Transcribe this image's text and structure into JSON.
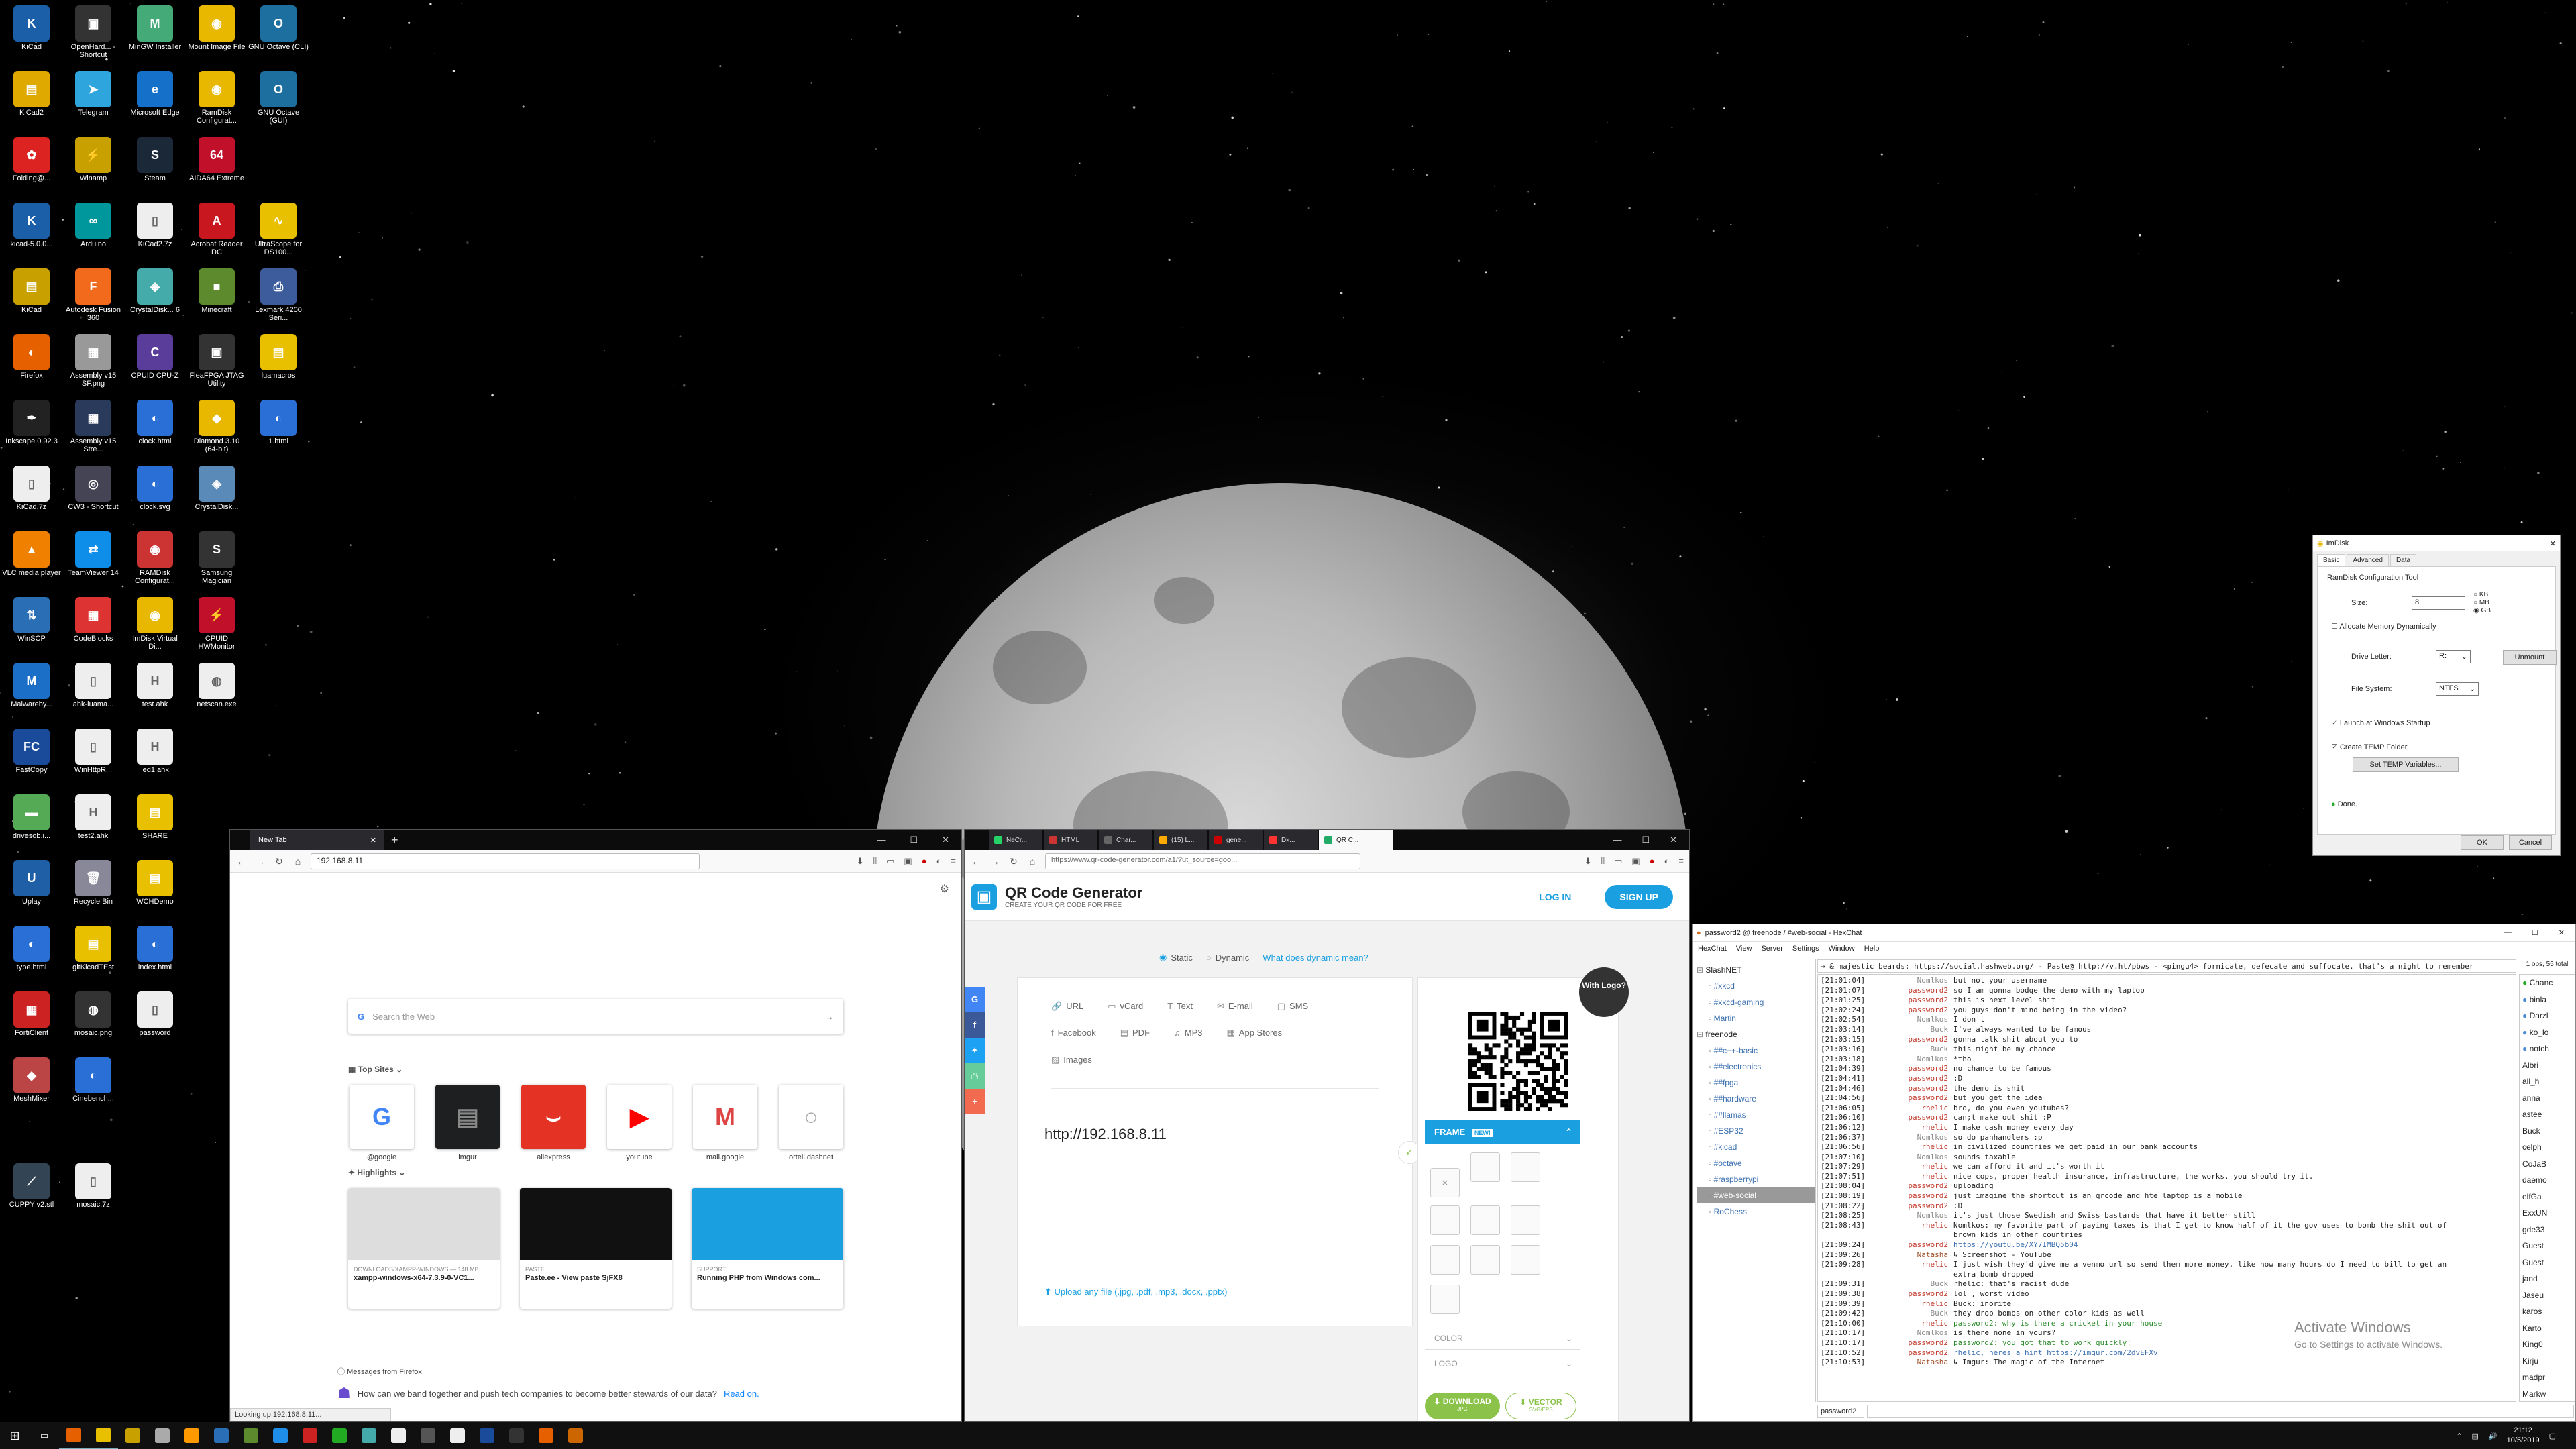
{
  "desktop": {
    "icons": [
      {
        "label": "KiCad",
        "color": "#1b5fa8",
        "glyph": "K"
      },
      {
        "label": "OpenHard... - Shortcut",
        "color": "#333",
        "glyph": "▣"
      },
      {
        "label": "MinGW Installer",
        "color": "#4a7",
        "glyph": "M"
      },
      {
        "label": "Mount Image File",
        "color": "#e8b800",
        "glyph": "◉"
      },
      {
        "label": "GNU Octave (CLI)",
        "color": "#1d6f9f",
        "glyph": "O"
      },
      {
        "label": "KiCad2",
        "color": "#e0a900",
        "glyph": "▤"
      },
      {
        "label": "Telegram",
        "color": "#2ea6dd",
        "glyph": "➤"
      },
      {
        "label": "Microsoft Edge",
        "color": "#1570c9",
        "glyph": "e"
      },
      {
        "label": "RamDisk Configurat...",
        "color": "#e8b800",
        "glyph": "◉"
      },
      {
        "label": "GNU Octave (GUI)",
        "color": "#1d6f9f",
        "glyph": "O"
      },
      {
        "label": "Folding@...",
        "color": "#d22",
        "glyph": "✿"
      },
      {
        "label": "Winamp",
        "color": "#c8a000",
        "glyph": "⚡"
      },
      {
        "label": "Steam",
        "color": "#1b2838",
        "glyph": "S"
      },
      {
        "label": "AIDA64 Extreme",
        "color": "#c0102a",
        "glyph": "64"
      },
      {
        "label": "kicad-5.0.0...",
        "color": "#1b5fa8",
        "glyph": "K"
      },
      {
        "label": "Arduino",
        "color": "#00979c",
        "glyph": "∞"
      },
      {
        "label": "KiCad2.7z",
        "color": "#eee",
        "glyph": "▯"
      },
      {
        "label": "Acrobat Reader DC",
        "color": "#c8171e",
        "glyph": "A"
      },
      {
        "label": "UltraScope for DS100...",
        "color": "#e8c000",
        "glyph": "∿"
      },
      {
        "label": "KiCad",
        "color": "#c8a000",
        "glyph": "▤"
      },
      {
        "label": "Autodesk Fusion 360",
        "color": "#f26a1b",
        "glyph": "F"
      },
      {
        "label": "CrystalDisk... 6",
        "color": "#4aa",
        "glyph": "◈"
      },
      {
        "label": "Minecraft",
        "color": "#5c8a2d",
        "glyph": "■"
      },
      {
        "label": "Lexmark 4200 Seri...",
        "color": "#3c5c9c",
        "glyph": "⎙"
      },
      {
        "label": "Firefox",
        "color": "#e66000",
        "glyph": "◐"
      },
      {
        "label": "Assembly v15 SF.png",
        "color": "#999",
        "glyph": "▦"
      },
      {
        "label": "CPUID CPU-Z",
        "color": "#5a3d9a",
        "glyph": "C"
      },
      {
        "label": "FleaFPGA JTAG Utility",
        "color": "#333",
        "glyph": "▣"
      },
      {
        "label": "luamacros",
        "color": "#e8c000",
        "glyph": "▤"
      },
      {
        "label": "Inkscape 0.92.3",
        "color": "#222",
        "glyph": "✒"
      },
      {
        "label": "Assembly v15 Stre...",
        "color": "#2a3a5a",
        "glyph": "▦"
      },
      {
        "label": "clock.html",
        "color": "#2a6fd6",
        "glyph": "◐"
      },
      {
        "label": "Diamond 3.10 (64-bit)",
        "color": "#e8b800",
        "glyph": "◆"
      },
      {
        "label": "1.html",
        "color": "#2a6fd6",
        "glyph": "◐"
      },
      {
        "label": "KiCad.7z",
        "color": "#eee",
        "glyph": "▯"
      },
      {
        "label": "CW3 - Shortcut",
        "color": "#445",
        "glyph": "◎"
      },
      {
        "label": "clock.svg",
        "color": "#2a6fd6",
        "glyph": "◐"
      },
      {
        "label": "CrystalDisk...",
        "color": "#5a8ab8",
        "glyph": "◈"
      },
      {
        "label": "VLC media player",
        "color": "#f08000",
        "glyph": "▲"
      },
      {
        "label": "TeamViewer 14",
        "color": "#0e8ee9",
        "glyph": "⇄"
      },
      {
        "label": "RAMDisk Configurat...",
        "color": "#c33",
        "glyph": "◉"
      },
      {
        "label": "Samsung Magician",
        "color": "#333",
        "glyph": "S"
      },
      {
        "label": "WinSCP",
        "color": "#2a6fb6",
        "glyph": "⇅"
      },
      {
        "label": "CodeBlocks",
        "color": "#d33",
        "glyph": "▦"
      },
      {
        "label": "ImDisk Virtual Di...",
        "color": "#e8b800",
        "glyph": "◉"
      },
      {
        "label": "CPUID HWMonitor",
        "color": "#c0102a",
        "glyph": "⚡"
      },
      {
        "label": "Malwareby...",
        "color": "#1c6fc6",
        "glyph": "M"
      },
      {
        "label": "ahk-luama...",
        "color": "#eee",
        "glyph": "▯"
      },
      {
        "label": "test.ahk",
        "color": "#eee",
        "glyph": "H"
      },
      {
        "label": "netscan.exe",
        "color": "#eee",
        "glyph": "◍"
      },
      {
        "label": "FastCopy",
        "color": "#1a4a9a",
        "glyph": "FC"
      },
      {
        "label": "WinHttpR...",
        "color": "#eee",
        "glyph": "▯"
      },
      {
        "label": "led1.ahk",
        "color": "#eee",
        "glyph": "H"
      },
      {
        "label": "drivesob.i...",
        "color": "#5a5",
        "glyph": "▬"
      },
      {
        "label": "test2.ahk",
        "color": "#eee",
        "glyph": "H"
      },
      {
        "label": "SHARE",
        "color": "#e8c000",
        "glyph": "▤"
      },
      {
        "label": "Uplay",
        "color": "#1e5fa5",
        "glyph": "U"
      },
      {
        "label": "Recycle Bin",
        "color": "#889",
        "glyph": "🗑"
      },
      {
        "label": "WCHDemo",
        "color": "#e8c000",
        "glyph": "▤"
      },
      {
        "label": "type.html",
        "color": "#2a6fd6",
        "glyph": "◐"
      },
      {
        "label": "gitKicadTEst",
        "color": "#e8c000",
        "glyph": "▤"
      },
      {
        "label": "index.html",
        "color": "#2a6fd6",
        "glyph": "◐"
      },
      {
        "label": "FortiClient",
        "color": "#c22",
        "glyph": "▦"
      },
      {
        "label": "mosaic.png",
        "color": "#333",
        "glyph": "◍"
      },
      {
        "label": "password",
        "color": "#eee",
        "glyph": "▯"
      },
      {
        "label": "MeshMixer",
        "color": "#b44",
        "glyph": "◆"
      },
      {
        "label": "Cinebench...",
        "color": "#2a6fd6",
        "glyph": "◐"
      },
      {
        "label": "CUPPY v2.stl",
        "color": "#345",
        "glyph": "⟋"
      },
      {
        "label": "mosaic.7z",
        "color": "#eee",
        "glyph": "▯"
      }
    ]
  },
  "firefox_left": {
    "tab_title": "New Tab",
    "url": "192.168.8.11",
    "search_placeholder": "Search the Web",
    "top_sites_label": "Top Sites",
    "highlights_label": "Highlights",
    "top_sites": [
      {
        "label": "@google",
        "bg": "#fff",
        "glyph": "G",
        "fg": "#4285f4"
      },
      {
        "label": "imgur",
        "bg": "#1e1f20",
        "glyph": "▤",
        "fg": "#888"
      },
      {
        "label": "aliexpress",
        "bg": "#e43225",
        "glyph": "⌣",
        "fg": "#fff"
      },
      {
        "label": "youtube",
        "bg": "#fff",
        "glyph": "▶",
        "fg": "#f00"
      },
      {
        "label": "mail.google",
        "bg": "#fff",
        "glyph": "M",
        "fg": "#d44"
      },
      {
        "label": "orteil.dashnet",
        "bg": "#fff",
        "glyph": "○",
        "fg": "#aaa"
      }
    ],
    "highlights": [
      {
        "meta": "DOWNLOADS/XAMPP-WINDOWS — 148 MB",
        "title": "xampp-windows-x64-7.3.9-0-VC1...",
        "color": "#ddd"
      },
      {
        "meta": "PASTE",
        "title": "Paste.ee - View paste SjFX8",
        "color": "#111"
      },
      {
        "meta": "SUPPORT",
        "title": "Running PHP from Windows com...",
        "color": "#1aa0e0"
      }
    ],
    "messages_header": "Messages from Firefox",
    "message_text": "How can we band together and push tech companies to become better stewards of our data?",
    "message_link": "Read on.",
    "status_text": "Looking up 192.168.8.11..."
  },
  "firefox_right": {
    "url": "https://www.qr-code-generator.com/a1/?ut_source=goo...",
    "tabs": [
      "NeCr...",
      "HTML",
      "Char...",
      "(15) L...",
      "gene...",
      "Dk...",
      "QR C..."
    ],
    "qr": {
      "brand": "QR Code Generator",
      "tagline": "CREATE YOUR QR CODE FOR FREE",
      "login": "LOG IN",
      "signup": "SIGN UP",
      "static": "Static",
      "dynamic": "Dynamic",
      "what_dynamic": "What does dynamic mean?",
      "types": [
        "URL",
        "vCard",
        "Text",
        "E-mail",
        "SMS",
        "Facebook",
        "PDF",
        "MP3",
        "App Stores",
        "Images"
      ],
      "input_value": "http://192.168.8.11",
      "upload": "Upload any file (.jpg, .pdf, .mp3, .docx, .pptx)",
      "with_logo": "With Logo?",
      "frame": "FRAME",
      "new_badge": "NEW!",
      "color": "COLOR",
      "logo": "LOGO",
      "download": "DOWNLOAD",
      "download_sub": "JPG",
      "vector": "VECTOR",
      "vector_sub": "SVG/EPS"
    }
  },
  "imdisk": {
    "title": "ImDisk",
    "tabs": [
      "Basic",
      "Advanced",
      "Data"
    ],
    "group": "RamDisk Configuration Tool",
    "size_label": "Size:",
    "size_value": "8",
    "units": [
      "KB",
      "MB",
      "GB"
    ],
    "alloc": "Allocate Memory Dynamically",
    "drive_letter_label": "Drive Letter:",
    "drive_letter": "R:",
    "unmount": "Unmount",
    "fs_label": "File System:",
    "fs": "NTFS",
    "launch": "Launch at Windows Startup",
    "create_temp": "Create TEMP Folder",
    "set_temp": "Set TEMP Variables...",
    "status": "Done.",
    "ok": "OK",
    "cancel": "Cancel"
  },
  "hexchat": {
    "title": "password2 @ freenode / #web-social - HexChat",
    "menu": [
      "HexChat",
      "View",
      "Server",
      "Settings",
      "Window",
      "Help"
    ],
    "topic": "→ & majestic beards: https://social.hashweb.org/ - Paste@ http://v.ht/pbws - <pingu4> fornicate, defecate and suffocate. that's a night to remember",
    "users_count": "1 ops, 55 total",
    "input_nick": "password2",
    "tree": [
      {
        "label": "SlashNET",
        "level": 0,
        "kind": "server"
      },
      {
        "label": "#xkcd",
        "level": 1
      },
      {
        "label": "#xkcd-gaming",
        "level": 1
      },
      {
        "label": "Martin",
        "level": 1
      },
      {
        "label": "freenode",
        "level": 0,
        "kind": "server"
      },
      {
        "label": "##c++-basic",
        "level": 1
      },
      {
        "label": "##electronics",
        "level": 1
      },
      {
        "label": "##fpga",
        "level": 1
      },
      {
        "label": "##hardware",
        "level": 1
      },
      {
        "label": "##llamas",
        "level": 1
      },
      {
        "label": "#ESP32",
        "level": 1
      },
      {
        "label": "#kicad",
        "level": 1
      },
      {
        "label": "#octave",
        "level": 1
      },
      {
        "label": "#raspberrypi",
        "level": 1
      },
      {
        "label": "#web-social",
        "level": 1,
        "active": true
      },
      {
        "label": "RoChess",
        "level": 1
      }
    ],
    "users": [
      "Chanc",
      "binla",
      "Darzl",
      "ko_lo",
      "notch",
      "Albri",
      "all_h",
      "anna",
      "astee",
      "Buck",
      "celph",
      "CoJaB",
      "daemo",
      "elfGa",
      "ExxUN",
      "gde33",
      "Guest",
      "Guest",
      "jand",
      "Jaseu",
      "karos",
      "Karto",
      "King0",
      "Kirju",
      "madpr",
      "Markw"
    ],
    "lines": [
      [
        "[21:01:04]",
        "Nomlkos",
        "but not your username"
      ],
      [
        "[21:01:07]",
        "password2",
        "so I am gonna bodge the demo with my laptop"
      ],
      [
        "[21:01:25]",
        "password2",
        "this is next level shit"
      ],
      [
        "[21:02:24]",
        "password2",
        "you guys don't mind being in the video?"
      ],
      [
        "[21:02:54]",
        "Nomlkos",
        "I don't"
      ],
      [
        "[21:03:14]",
        "Buck",
        "I've always wanted to be famous"
      ],
      [
        "[21:03:15]",
        "password2",
        "gonna talk shit about you to"
      ],
      [
        "[21:03:16]",
        "Buck",
        "this might be my chance"
      ],
      [
        "[21:03:18]",
        "Nomlkos",
        "*tho"
      ],
      [
        "[21:04:39]",
        "password2",
        "no chance to be famous"
      ],
      [
        "[21:04:41]",
        "password2",
        ":D"
      ],
      [
        "[21:04:46]",
        "password2",
        "the demo is shit"
      ],
      [
        "[21:04:56]",
        "password2",
        "but you get the idea"
      ],
      [
        "[21:06:05]",
        "rhelic",
        "bro, do you even youtubes?"
      ],
      [
        "[21:06:10]",
        "password2",
        "can;t make out shit :P"
      ],
      [
        "[21:06:12]",
        "rhelic",
        "I make cash money every day"
      ],
      [
        "[21:06:37]",
        "Nomlkos",
        "so do panhandlers :p"
      ],
      [
        "[21:06:56]",
        "rhelic",
        "in civilized countries we get paid in our bank accounts"
      ],
      [
        "[21:07:10]",
        "Nomlkos",
        "sounds taxable"
      ],
      [
        "[21:07:29]",
        "rhelic",
        "we can afford it and it's worth it"
      ],
      [
        "[21:07:51]",
        "rhelic",
        "nice cops, proper health insurance, infrastructure, the works. you should try it."
      ],
      [
        "[21:08:04]",
        "password2",
        "uploading"
      ],
      [
        "[21:08:19]",
        "password2",
        "just imagine the shortcut is an qrcode and hte laptop is a mobile"
      ],
      [
        "[21:08:22]",
        "password2",
        ":D"
      ],
      [
        "[21:08:25]",
        "Nomlkos",
        "it's just those Swedish and Swiss bastards that have it better still"
      ],
      [
        "[21:08:43]",
        "rhelic",
        "Nomlkos: my favorite part of paying taxes is that I get to know half of it the gov uses to bomb the shit out of"
      ],
      [
        "",
        "",
        "brown kids in other countries"
      ],
      [
        "[21:09:24]",
        "password2",
        "https://youtu.be/XY7IMBQ5b04"
      ],
      [
        "[21:09:26]",
        "Natasha",
        "↳ Screenshot - YouTube"
      ],
      [
        "[21:09:28]",
        "rhelic",
        "I just wish they'd give me a venmo url so send them more money, like how many hours do I need to bill to get an"
      ],
      [
        "",
        "",
        "extra bomb dropped"
      ],
      [
        "[21:09:31]",
        "Buck",
        "rhelic: that's racist dude"
      ],
      [
        "[21:09:38]",
        "password2",
        "lol , worst video"
      ],
      [
        "[21:09:39]",
        "rhelic",
        "Buck: inorite"
      ],
      [
        "[21:09:42]",
        "Buck",
        "they drop bombs on other color kids as well"
      ],
      [
        "[21:10:00]",
        "rhelic",
        "password2: why is there a cricket in your house"
      ],
      [
        "[21:10:17]",
        "Nomlkos",
        "is there none in yours?"
      ],
      [
        "[21:10:17]",
        "password2",
        "password2: you got that to work quickly!"
      ],
      [
        "[21:10:52]",
        "password2",
        "rhelic, heres a hint https://imgur.com/2dvEFXv"
      ],
      [
        "[21:10:53]",
        "Natasha",
        "↳ Imgur: The magic of the Internet"
      ]
    ],
    "nick_colors": {
      "Nomlkos": "#8a8a8a",
      "password2": "#c0392b",
      "Buck": "#8a8a8a",
      "rhelic": "#c0392b",
      "Natasha": "#a0522d"
    }
  },
  "watermark": {
    "line1": "Activate Windows",
    "line2": "Go to Settings to activate Windows."
  },
  "clock": {
    "time": "21:12",
    "date": "10/5/2019"
  }
}
